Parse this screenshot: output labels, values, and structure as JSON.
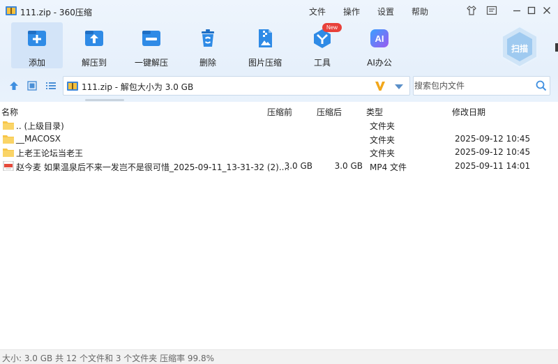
{
  "window": {
    "title": "111.zip - 360压缩",
    "menu": [
      "文件",
      "操作",
      "设置",
      "帮助"
    ]
  },
  "toolbar": {
    "items": [
      {
        "label": "添加",
        "icon": "add-icon",
        "active": true
      },
      {
        "label": "解压到",
        "icon": "extract-to-icon"
      },
      {
        "label": "一键解压",
        "icon": "one-click-extract-icon"
      },
      {
        "label": "删除",
        "icon": "delete-icon"
      },
      {
        "label": "图片压缩",
        "icon": "image-compress-icon"
      },
      {
        "label": "工具",
        "icon": "tools-icon",
        "badge": "New"
      },
      {
        "label": "AI办公",
        "icon": "ai-office-icon",
        "icon_text": "AI"
      }
    ],
    "scan_label": "扫描"
  },
  "address": {
    "path_text": "111.zip - 解包大小为 3.0 GB"
  },
  "search": {
    "placeholder": "搜索包内文件"
  },
  "columns": {
    "name": "名称",
    "packed": "压缩前",
    "compressed": "压缩后",
    "type": "类型",
    "modified": "修改日期"
  },
  "files": [
    {
      "name": ".. (上级目录)",
      "packed": "",
      "compressed": "",
      "type": "文件夹",
      "modified": "",
      "icon": "folder-icon"
    },
    {
      "name": "__MACOSX",
      "packed": "",
      "compressed": "",
      "type": "文件夹",
      "modified": "2025-09-12 10:45",
      "icon": "folder-icon"
    },
    {
      "name": "上老王论坛当老王",
      "packed": "",
      "compressed": "",
      "type": "文件夹",
      "modified": "2025-09-12 10:45",
      "icon": "folder-icon"
    },
    {
      "name": "赵今麦 如果温泉后不来一发岂不是很可惜_2025-09-11_13-31-32 (2)....",
      "packed": "3.0 GB",
      "compressed": "3.0 GB",
      "type": "MP4 文件",
      "modified": "2025-09-11 14:01",
      "icon": "mp4-file-icon"
    }
  ],
  "status": {
    "text": "大小: 3.0 GB 共 12 个文件和 3 个文件夹 压缩率 99.8%"
  },
  "colors": {
    "accent": "#2f8be6",
    "toolbar_bg": "#e8f1fb",
    "active_tool_bg": "#d3e4f8",
    "badge_red": "#e8413a",
    "folder_yellow": "#f7c548"
  }
}
